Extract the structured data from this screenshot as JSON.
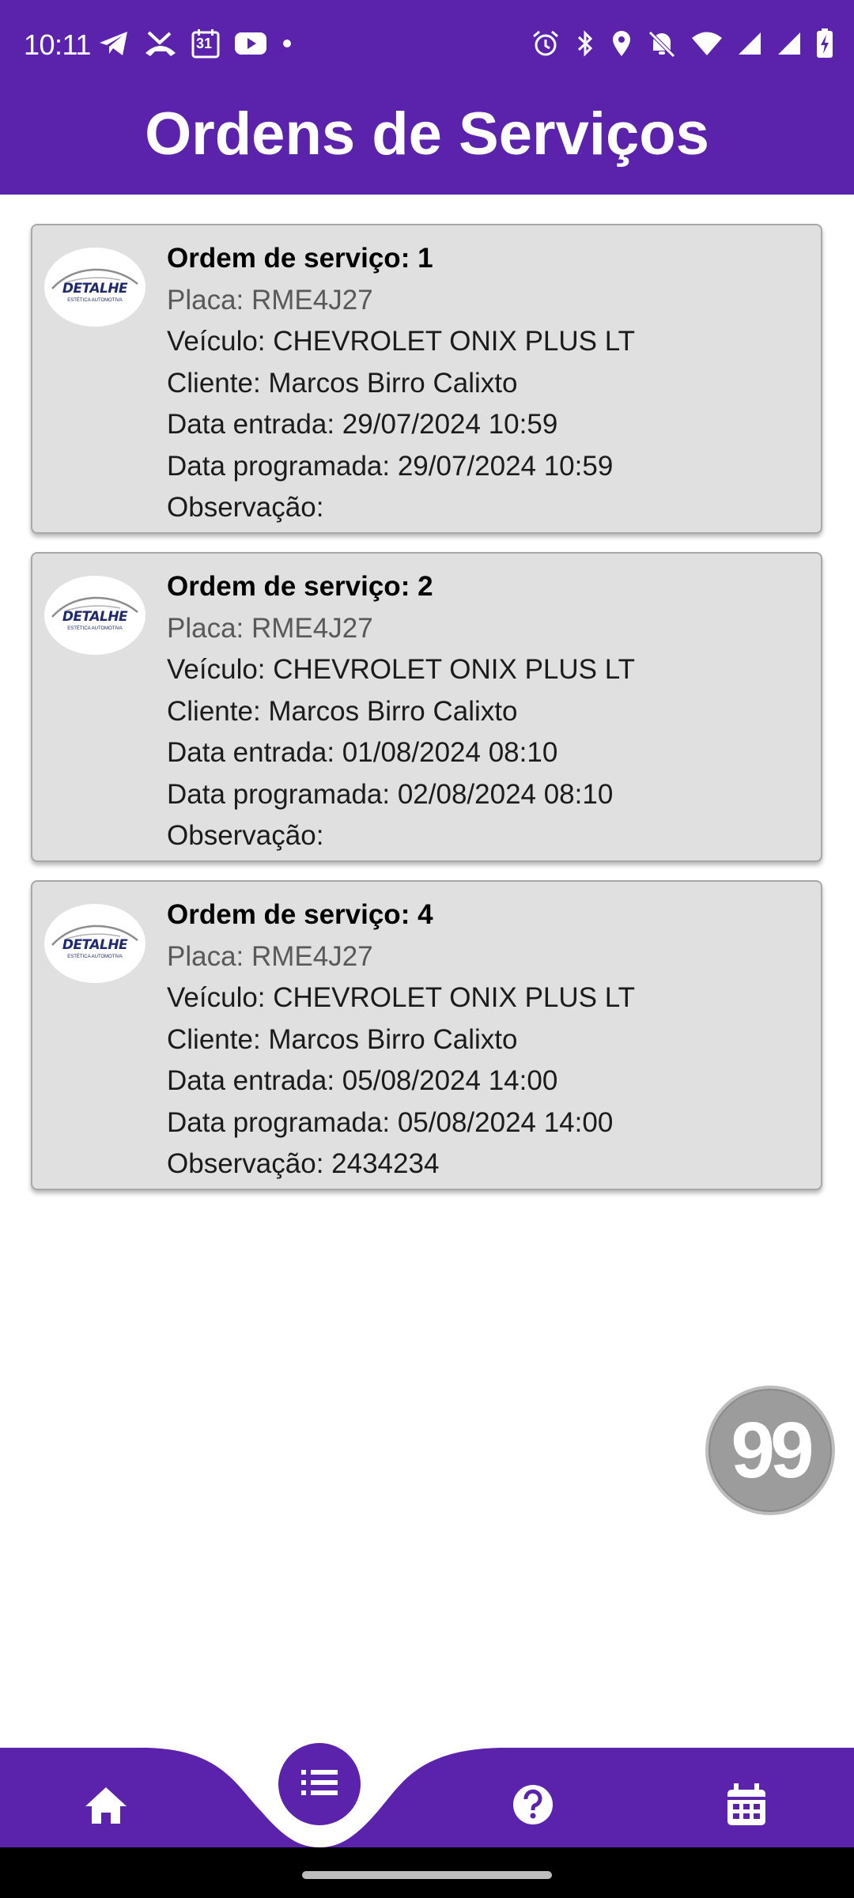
{
  "status_bar": {
    "time": "10:11",
    "calendar_day": "31",
    "left_icons": [
      "telegram-icon",
      "missed-call-icon",
      "calendar-icon",
      "youtube-icon",
      "dot-icon"
    ],
    "right_icons": [
      "alarm-icon",
      "bluetooth-icon",
      "location-icon",
      "mute-icon",
      "wifi-icon",
      "signal-icon",
      "signal-icon",
      "battery-charging-icon"
    ]
  },
  "header": {
    "title": "Ordens de Serviços"
  },
  "orders": [
    {
      "title": "Ordem de serviço: 1",
      "plate": "Placa: RME4J27",
      "vehicle": "Veículo: CHEVROLET ONIX PLUS LT",
      "client": "Cliente: Marcos Birro Calixto",
      "entry": "Data entrada: 29/07/2024 10:59",
      "scheduled": "Data programada: 29/07/2024 10:59",
      "note": "Observação:"
    },
    {
      "title": "Ordem de serviço: 2",
      "plate": "Placa: RME4J27",
      "vehicle": "Veículo: CHEVROLET ONIX PLUS LT",
      "client": "Cliente: Marcos Birro Calixto",
      "entry": "Data entrada: 01/08/2024 08:10",
      "scheduled": "Data programada: 02/08/2024 08:10",
      "note": "Observação:"
    },
    {
      "title": "Ordem de serviço: 4",
      "plate": "Placa: RME4J27",
      "vehicle": "Veículo: CHEVROLET ONIX PLUS LT",
      "client": "Cliente: Marcos Birro Calixto",
      "entry": "Data entrada: 05/08/2024 14:00",
      "scheduled": "Data programada: 05/08/2024 14:00",
      "note": "Observação: 2434234"
    }
  ],
  "logo": {
    "text": "DETALHE",
    "subtext": "ESTÉTICA AUTOMOTIVA"
  },
  "floating_badge": {
    "label": "99"
  },
  "bottom_nav": {
    "items": [
      "home-icon",
      "list-icon",
      "help-icon",
      "calendar-icon"
    ],
    "active": "list-icon"
  },
  "colors": {
    "primary": "#5b22ac",
    "card_background": "#e0e0e0",
    "badge": "#9c9c9c"
  }
}
